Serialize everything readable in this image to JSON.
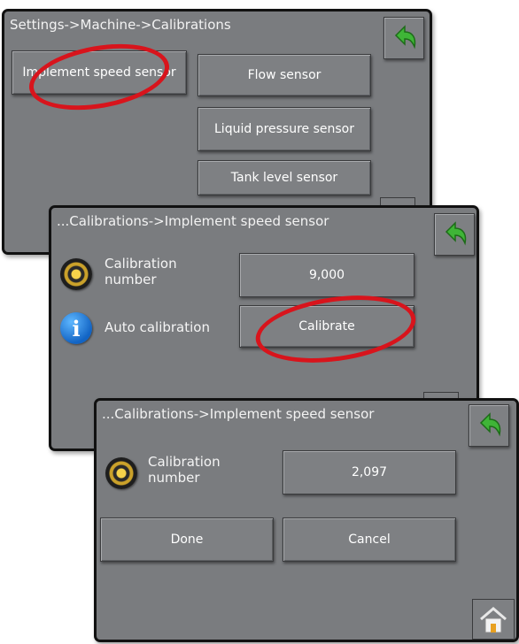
{
  "colors": {
    "panel_bg": "#7a7c7f",
    "frame": "#111111",
    "button_bg": "#7e8083",
    "text": "#ffffff",
    "annotation": "#d8141c",
    "back_arrow": "#3fb537"
  },
  "screen1": {
    "breadcrumb": "Settings->Machine->Calibrations",
    "buttons": {
      "implement_speed_sensor": "Implement speed sensor",
      "flow_sensor": "Flow sensor",
      "liquid_pressure_sensor": "Liquid pressure sensor",
      "tank_level_sensor": "Tank level sensor"
    },
    "back_icon": "back-arrow-icon"
  },
  "screen2": {
    "breadcrumb": "...Calibrations->Implement speed sensor",
    "calibration_label": "Calibration number",
    "calibration_value": "9,000",
    "auto_calibration_label": "Auto calibration",
    "calibrate_button": "Calibrate",
    "back_icon": "back-arrow-icon"
  },
  "screen3": {
    "breadcrumb": "...Calibrations->Implement speed sensor",
    "calibration_label": "Calibration number",
    "calibration_value": "2,097",
    "done_button": "Done",
    "cancel_button": "Cancel",
    "back_icon": "back-arrow-icon",
    "home_icon": "home-icon"
  }
}
